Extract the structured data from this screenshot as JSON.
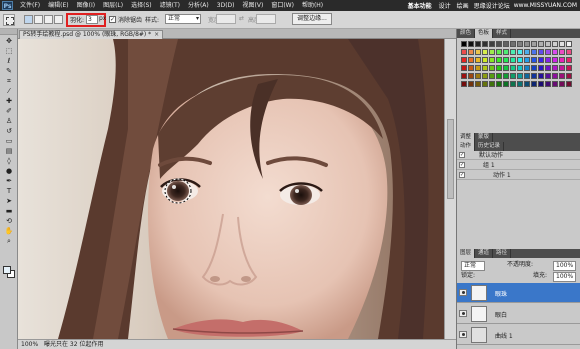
{
  "app": {
    "logo": "Ps",
    "menus": [
      "文件(F)",
      "编辑(E)",
      "图像(I)",
      "图层(L)",
      "选择(S)",
      "滤镜(T)",
      "分析(A)",
      "3D(D)",
      "视图(V)",
      "窗口(W)",
      "帮助(H)"
    ],
    "zoom_indicator": "100%",
    "workspace": "基本功能",
    "workspace_tabs": [
      "设计",
      "绘画"
    ],
    "watermark_1": "思缘设计论坛",
    "watermark_2": "www.MISSYUAN.COM"
  },
  "options": {
    "feather_label": "羽化:",
    "feather_value": "3",
    "feather_unit": "px",
    "antialias_label": "消除锯齿",
    "antialias_checked": true,
    "style_label": "样式:",
    "style_value": "正常",
    "width_label": "宽度:",
    "height_label": "高度:",
    "refine_button": "调整边缘..."
  },
  "document": {
    "tab_title": "PS转手绘教程.psd @ 100% (眼珠, RGB/8#) *",
    "close_glyph": "×",
    "status_zoom": "100%",
    "status_info": "曝光只在 32 位起作用"
  },
  "colors": {
    "foreground": "#e6f2fa",
    "background": "#ffffff",
    "selected_layer": "#3a77c9",
    "feather_highlight": "#e02020"
  },
  "panels": {
    "top_tabs": [
      "颜色",
      "色板",
      "样式"
    ],
    "middle_tabs": [
      "调整",
      "蒙版"
    ],
    "actions_tabs": [
      "动作",
      "历史记录"
    ],
    "actions": [
      {
        "label": "默认动作",
        "type": "set"
      },
      {
        "label": "组 1",
        "type": "set"
      },
      {
        "label": "动作 1",
        "type": "action"
      }
    ],
    "layers_tabs": [
      "图层",
      "通道",
      "路径"
    ],
    "blend_mode": "正常",
    "opacity_label": "不透明度:",
    "opacity_value": "100%",
    "lock_label": "锁定:",
    "fill_label": "填充:",
    "fill_value": "100%",
    "layers": [
      {
        "name": "眼珠",
        "selected": true
      },
      {
        "name": "眼白",
        "selected": false
      },
      {
        "name": "曲线 1",
        "selected": false
      }
    ]
  }
}
